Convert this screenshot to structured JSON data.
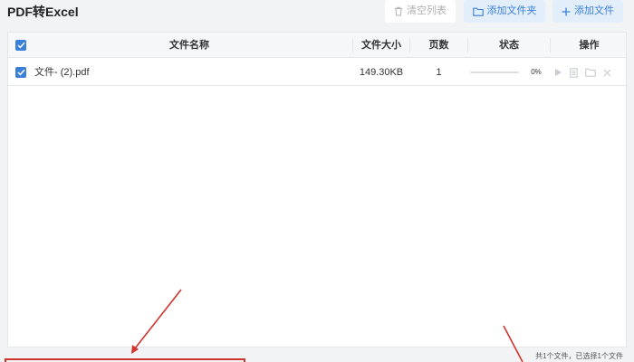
{
  "app": {
    "title": "PDF转Excel"
  },
  "toolbar": {
    "clear_label": "清空列表",
    "add_folder_label": "添加文件夹",
    "add_file_label": "添加文件"
  },
  "table": {
    "columns": {
      "name": "文件名称",
      "size": "文件大小",
      "pages": "页数",
      "status": "状态",
      "actions": "操作"
    },
    "rows": [
      {
        "name": "文件- (2).pdf",
        "size": "149.30KB",
        "pages": "1",
        "progress_text": "0%",
        "progress": 0,
        "checked": true
      }
    ]
  },
  "status_bar": {
    "text": "共1个文件，已选择1个文件"
  },
  "colors": {
    "accent": "#3a7fd8",
    "annotation": "#d0342c"
  },
  "icons": {
    "clear": "trash-icon",
    "add_folder": "folder-icon",
    "add_file": "plus-icon",
    "row_actions": [
      "play-icon",
      "document-icon",
      "folder-icon",
      "close-icon"
    ]
  }
}
